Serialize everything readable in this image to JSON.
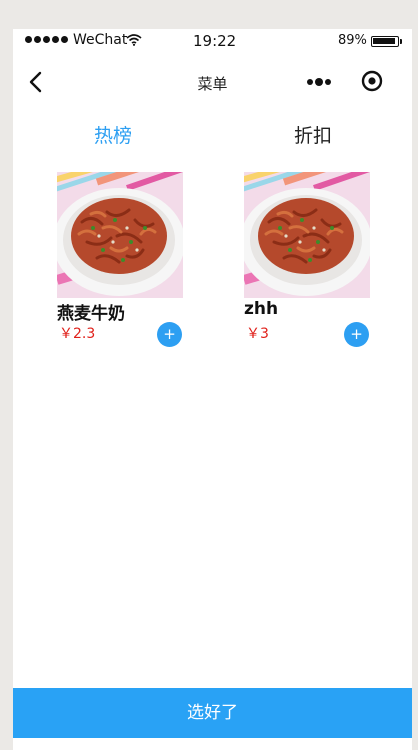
{
  "status_bar": {
    "carrier": "WeChat",
    "time": "19:22",
    "battery": "89%"
  },
  "nav": {
    "title": "菜单"
  },
  "tabs": [
    {
      "label": "热榜",
      "active": true
    },
    {
      "label": "折扣",
      "active": false
    }
  ],
  "products": [
    {
      "name": "燕麦牛奶",
      "price": "￥2.3",
      "add_label": "+"
    },
    {
      "name": "zhh",
      "price": "￥3",
      "add_label": "+"
    }
  ],
  "confirm_button": {
    "label": "选好了"
  },
  "colors": {
    "accent": "#2d9ff2",
    "price": "#e0201a",
    "confirm_bar": "#29a2f5"
  }
}
